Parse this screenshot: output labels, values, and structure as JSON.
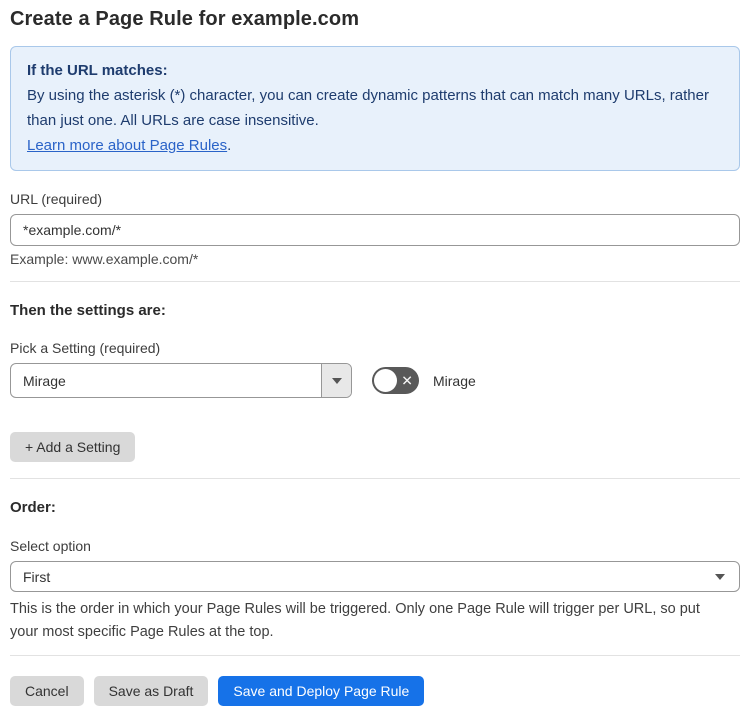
{
  "page": {
    "title": "Create a Page Rule for example.com"
  },
  "info_box": {
    "heading": "If the URL matches:",
    "body": "By using the asterisk (*) character, you can create dynamic patterns that can match many URLs, rather than just one. All URLs are case insensitive.",
    "link_label": "Learn more about Page Rules",
    "link_suffix": "."
  },
  "url_field": {
    "label": "URL (required)",
    "value": "*example.com/*",
    "example": "Example: www.example.com/*"
  },
  "settings_section": {
    "heading": "Then the settings are:",
    "pick_label": "Pick a Setting (required)",
    "selected_setting": "Mirage",
    "toggle": {
      "label": "Mirage",
      "state": "off",
      "off_glyph": "✕"
    },
    "add_button_label": "+ Add a Setting"
  },
  "order_section": {
    "heading": "Order:",
    "select_label": "Select option",
    "selected_option": "First",
    "help_text": "This is the order in which your Page Rules will be triggered. Only one Page Rule will trigger per URL, so put your most specific Page Rules at the top."
  },
  "footer": {
    "cancel_label": "Cancel",
    "save_draft_label": "Save as Draft",
    "save_deploy_label": "Save and Deploy Page Rule"
  },
  "colors": {
    "info_background": "#e8f1fb",
    "info_border": "#a9c8ea",
    "info_text": "#1e3c6e",
    "link_blue": "#2a63c8",
    "primary_button_blue": "#1672e8",
    "gray_button": "#d9d9d9",
    "input_border": "#979797",
    "toggle_off": "#595959"
  }
}
